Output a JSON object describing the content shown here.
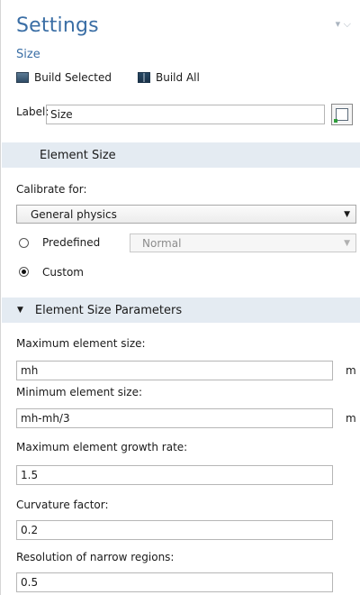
{
  "settings": {
    "title": "Settings",
    "pin_icon": "▾ ⌵",
    "subtitle": "Size",
    "toolbar": {
      "build_selected": "Build Selected",
      "build_all": "Build All"
    },
    "label": {
      "caption": "Label:",
      "value": "Size"
    },
    "element_size": {
      "header": "Element Size",
      "calibrate_for_label": "Calibrate for:",
      "calibrate_for_value": "General physics",
      "predefined_label": "Predefined",
      "predefined_value": "Normal",
      "custom_label": "Custom",
      "selected_option": "custom"
    },
    "parameters": {
      "header": "Element Size Parameters",
      "fields": [
        {
          "label": "Maximum element size:",
          "value": "mh",
          "unit": "m"
        },
        {
          "label": "Minimum element size:",
          "value": "mh-mh/3",
          "unit": "m"
        },
        {
          "label": "Maximum element growth rate:",
          "value": "1.5"
        },
        {
          "label": "Curvature factor:",
          "value": "0.2"
        },
        {
          "label": "Resolution of narrow regions:",
          "value": "0.5"
        }
      ]
    }
  }
}
